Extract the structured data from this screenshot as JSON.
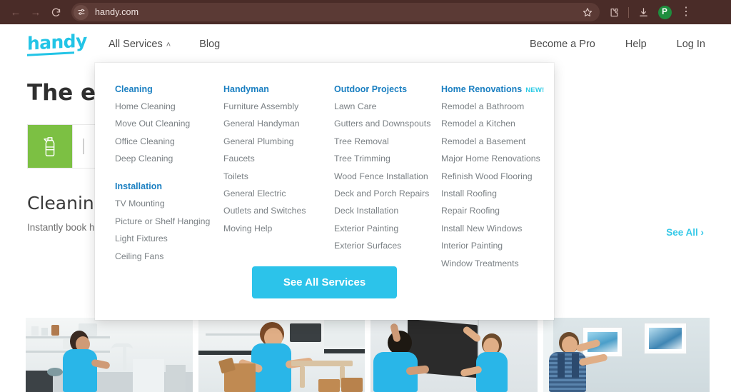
{
  "browser": {
    "back_icon": "back-arrow-icon",
    "forward_icon": "forward-arrow-icon",
    "reload_icon": "reload-icon",
    "site_settings_icon": "tune-sliders-icon",
    "url": "handy.com",
    "bookmark_icon": "star-icon",
    "extensions_icon": "puzzle-extensions-icon",
    "download_icon": "download-icon",
    "profile_initial": "P",
    "menu_icon": "three-dot-menu-icon",
    "bar_color": "#4a2c28"
  },
  "header": {
    "logo_text": "handy",
    "logo_color": "#22c4e6",
    "nav": [
      {
        "label": "All Services",
        "caret": "˄"
      },
      {
        "label": "Blog",
        "caret": ""
      }
    ],
    "right_links": [
      {
        "label": "Become a Pro"
      },
      {
        "label": "Help"
      },
      {
        "label": "Log In"
      }
    ]
  },
  "hero": {
    "title": "The ea",
    "chip_icon": "spray-bottle-icon",
    "chip_color": "#7cc043"
  },
  "section": {
    "title": "Cleaning",
    "subtitle": "Instantly book hi",
    "see_all": "See All ›",
    "see_all_color": "#36c9e8"
  },
  "cards": [
    {
      "alt": "woman-cleaning-kitchen"
    },
    {
      "alt": "man-assembling-furniture"
    },
    {
      "alt": "two-men-mounting-tv"
    },
    {
      "alt": "man-hanging-picture-frame"
    }
  ],
  "mega_menu": {
    "columns": [
      {
        "groups": [
          {
            "heading": "Cleaning",
            "badge": "",
            "items": [
              "Home Cleaning",
              "Move Out Cleaning",
              "Office Cleaning",
              "Deep Cleaning"
            ]
          },
          {
            "heading": "Installation",
            "badge": "",
            "items": [
              "TV Mounting",
              "Picture or Shelf Hanging",
              "Light Fixtures",
              "Ceiling Fans"
            ]
          }
        ]
      },
      {
        "groups": [
          {
            "heading": "Handyman",
            "badge": "",
            "items": [
              "Furniture Assembly",
              "General Handyman",
              "General Plumbing",
              "Faucets",
              "Toilets",
              "General Electric",
              "Outlets and Switches",
              "Moving Help"
            ]
          }
        ]
      },
      {
        "groups": [
          {
            "heading": "Outdoor Projects",
            "badge": "",
            "items": [
              "Lawn Care",
              "Gutters and Downspouts",
              "Tree Removal",
              "Tree Trimming",
              "Wood Fence Installation",
              "Deck and Porch Repairs",
              "Deck Installation",
              "Exterior Painting",
              "Exterior Surfaces"
            ]
          }
        ]
      },
      {
        "groups": [
          {
            "heading": "Home Renovations",
            "badge": "NEW!",
            "items": [
              "Remodel a Bathroom",
              "Remodel a Kitchen",
              "Remodel a Basement",
              "Major Home Renovations",
              "Refinish Wood Flooring",
              "Install Roofing",
              "Repair Roofing",
              "Install New Windows",
              "Interior Painting",
              "Window Treatments"
            ]
          }
        ]
      }
    ],
    "cta_label": "See All Services",
    "cta_color": "#2cc3ea",
    "heading_color": "#1a7fc1",
    "badge_color": "#2ecbe5"
  }
}
